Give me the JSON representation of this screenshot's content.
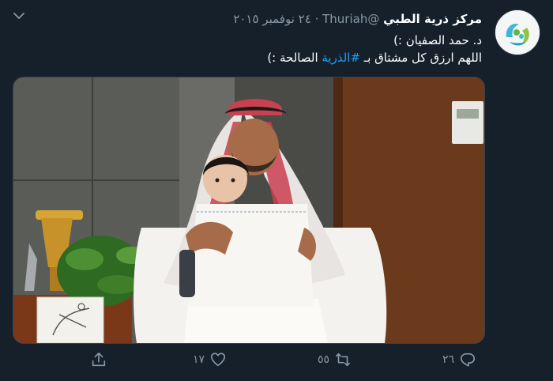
{
  "tweet": {
    "author_name": "مركز ذرية الطبي",
    "handle": "@Thuriah",
    "separator": "·",
    "date": "٢٤ نوفمبر ٢٠١٥",
    "line1": "د. حمد الصفيان :)",
    "line2_prefix": "اللهم ارزق كل مشتاق بـ ",
    "hashtag": "#الذرية",
    "line2_suffix": " الصالحة :)",
    "media_alt": "Man in red-and-white shemagh holding a baby in a white dress"
  },
  "actions": {
    "reply_count": "٢٦",
    "retweet_count": "٥٥",
    "like_count": "١٧"
  },
  "colors": {
    "background": "#15202b",
    "text": "#ffffff",
    "secondary": "#8899a6",
    "link": "#1da1f2"
  },
  "icons": [
    "chevron-down-icon",
    "reply-icon",
    "retweet-icon",
    "like-icon",
    "share-icon"
  ]
}
